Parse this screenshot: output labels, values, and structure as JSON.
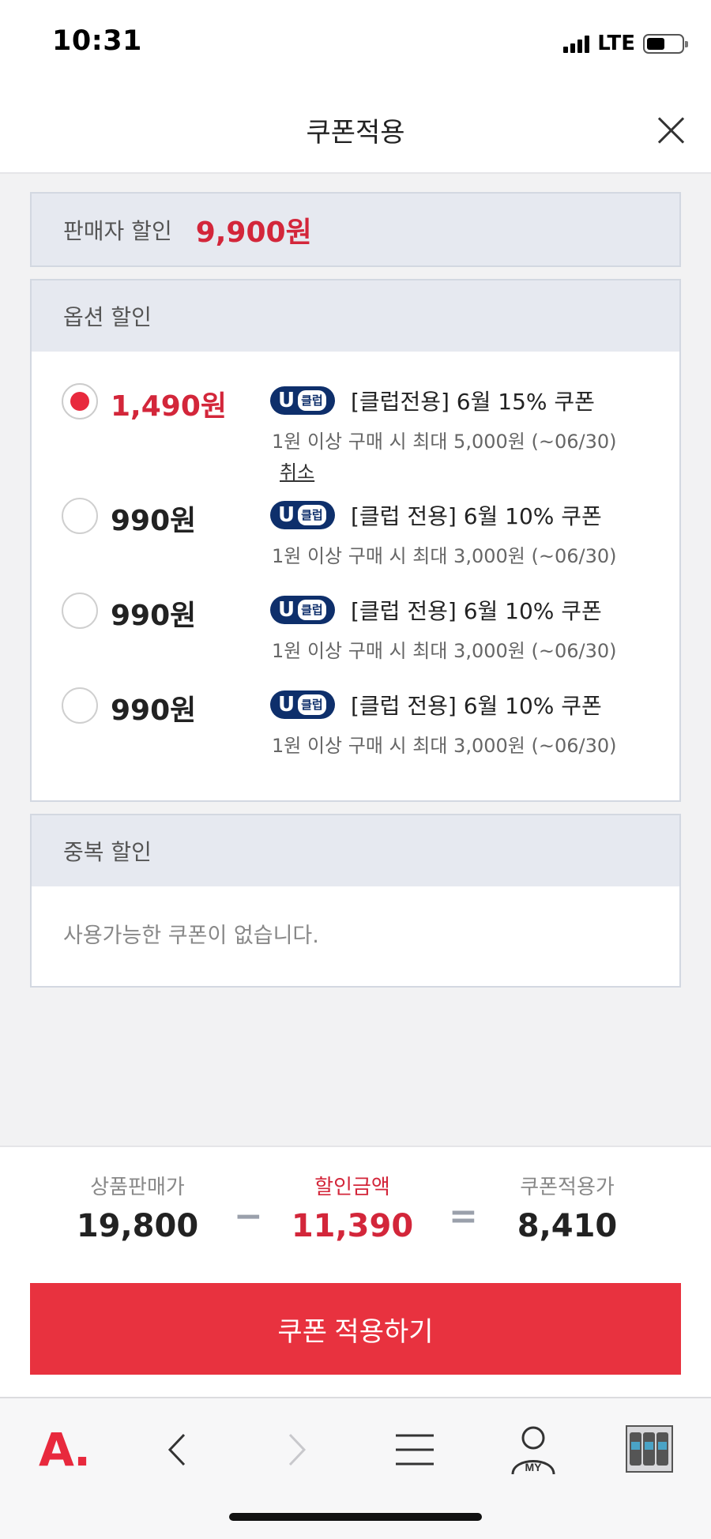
{
  "status_bar": {
    "time": "10:31",
    "network": "LTE"
  },
  "header": {
    "title": "쿠폰적용"
  },
  "seller_discount": {
    "label": "판매자 할인",
    "amount": "9,900원"
  },
  "option_discount": {
    "title": "옵션 할인",
    "coupons": [
      {
        "amount": "1,490원",
        "selected": true,
        "badge_u": "U",
        "badge_text": "클럽",
        "name": "[클럽전용] 6월 15% 쿠폰",
        "condition": "1원 이상 구매 시 최대 5,000원 (~06/30)",
        "cancel": "취소"
      },
      {
        "amount": "990원",
        "selected": false,
        "badge_u": "U",
        "badge_text": "클럽",
        "name": "[클럽 전용] 6월 10% 쿠폰",
        "condition": "1원 이상 구매 시 최대 3,000원 (~06/30)"
      },
      {
        "amount": "990원",
        "selected": false,
        "badge_u": "U",
        "badge_text": "클럽",
        "name": "[클럽 전용] 6월 10% 쿠폰",
        "condition": "1원 이상 구매 시 최대 3,000원 (~06/30)"
      },
      {
        "amount": "990원",
        "selected": false,
        "badge_u": "U",
        "badge_text": "클럽",
        "name": "[클럽 전용] 6월 10% 쿠폰",
        "condition": "1원 이상 구매 시 최대 3,000원 (~06/30)"
      }
    ]
  },
  "duplicate_discount": {
    "title": "중복 할인",
    "empty_text": "사용가능한 쿠폰이 없습니다."
  },
  "summary": {
    "price_label": "상품판매가",
    "price_value": "19,800",
    "minus": "−",
    "discount_label": "할인금액",
    "discount_value": "11,390",
    "equals": "=",
    "final_label": "쿠폰적용가",
    "final_value": "8,410"
  },
  "apply_button": {
    "label": "쿠폰 적용하기"
  },
  "bottom_nav": {
    "logo": "A.",
    "my_label": "MY"
  },
  "colors": {
    "accent_red": "#e8323f",
    "price_red": "#d3263a",
    "badge_navy": "#0e2f6b",
    "section_bg": "#e6e9f0"
  }
}
